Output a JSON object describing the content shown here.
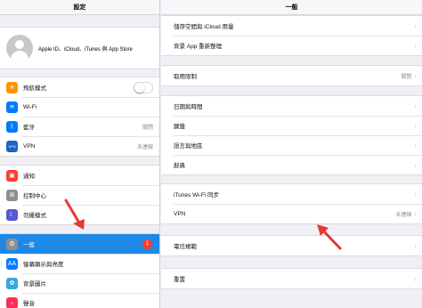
{
  "sidebar": {
    "title": "設定",
    "profile_label": "Apple ID、iCloud、iTunes 與 App Store",
    "group1": [
      {
        "label": "飛航模式",
        "value": "",
        "color": "#ff9500",
        "icon": "airplane-icon",
        "glyph": "✈"
      },
      {
        "label": "Wi-Fi",
        "value": "",
        "color": "#007aff",
        "icon": "wifi-icon",
        "glyph": "≋"
      },
      {
        "label": "藍牙",
        "value": "關閉",
        "color": "#007aff",
        "icon": "bluetooth-icon",
        "glyph": "ᛒ"
      },
      {
        "label": "VPN",
        "value": "未連線",
        "color": "#1a64c8",
        "icon": "vpn-icon",
        "glyph": "VPN"
      }
    ],
    "group2": [
      {
        "label": "通知",
        "color": "#ff3b30",
        "icon": "notifications-icon",
        "glyph": "▣"
      },
      {
        "label": "控制中心",
        "color": "#8e8e93",
        "icon": "control-center-icon",
        "glyph": "⊞"
      },
      {
        "label": "勿擾模式",
        "color": "#5856d6",
        "icon": "moon-icon",
        "glyph": "☾"
      }
    ],
    "group3": [
      {
        "label": "一般",
        "color": "#8e8e93",
        "icon": "gear-icon",
        "glyph": "⚙",
        "badge": "1"
      },
      {
        "label": "螢幕顯示與亮度",
        "color": "#007aff",
        "icon": "display-brightness-icon",
        "glyph": "AA"
      },
      {
        "label": "背景圖片",
        "color": "#34aadc",
        "icon": "wallpaper-icon",
        "glyph": "✿"
      },
      {
        "label": "聲音",
        "color": "#ff2d55",
        "icon": "sound-icon",
        "glyph": "♪"
      }
    ]
  },
  "detail": {
    "title": "一般",
    "group1": [
      {
        "label": "儲存空間與 iCloud 用量",
        "value": ""
      },
      {
        "label": "背景 App 重新整理",
        "value": ""
      }
    ],
    "group2": [
      {
        "label": "取用限制",
        "value": "關閉"
      }
    ],
    "group3": [
      {
        "label": "日期與時間",
        "value": ""
      },
      {
        "label": "鍵盤",
        "value": ""
      },
      {
        "label": "語言與地區",
        "value": ""
      },
      {
        "label": "辭典",
        "value": ""
      }
    ],
    "group4": [
      {
        "label": "iTunes Wi-Fi 同步",
        "value": ""
      },
      {
        "label": "VPN",
        "value": "未連線"
      }
    ],
    "group5": [
      {
        "label": "電信規範",
        "value": ""
      }
    ],
    "group6": [
      {
        "label": "重置",
        "value": ""
      }
    ]
  },
  "colors": {
    "accent": "#1e88e5",
    "annotation_arrow": "#e53935",
    "badge": "#ff3b30"
  }
}
